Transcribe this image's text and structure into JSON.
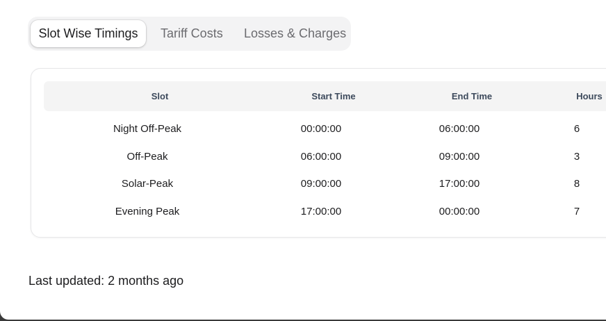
{
  "tabs": [
    {
      "label": "Slot Wise Timings",
      "active": true
    },
    {
      "label": "Tariff Costs",
      "active": false
    },
    {
      "label": "Losses & Charges",
      "active": false
    }
  ],
  "table": {
    "columns": [
      "Slot",
      "Start Time",
      "End Time",
      "Hours"
    ],
    "rows": [
      [
        "Night Off-Peak",
        "00:00:00",
        "06:00:00",
        "6"
      ],
      [
        "Off-Peak",
        "06:00:00",
        "09:00:00",
        "3"
      ],
      [
        "Solar-Peak",
        "09:00:00",
        "17:00:00",
        "8"
      ],
      [
        "Evening Peak",
        "17:00:00",
        "00:00:00",
        "7"
      ]
    ]
  },
  "footer": {
    "last_updated": "Last updated: 2 months ago"
  },
  "colors": {
    "header_text": "#3d4a5c",
    "header_bg": "#f4f4f4",
    "tab_bar_bg": "#f3f3f4"
  }
}
